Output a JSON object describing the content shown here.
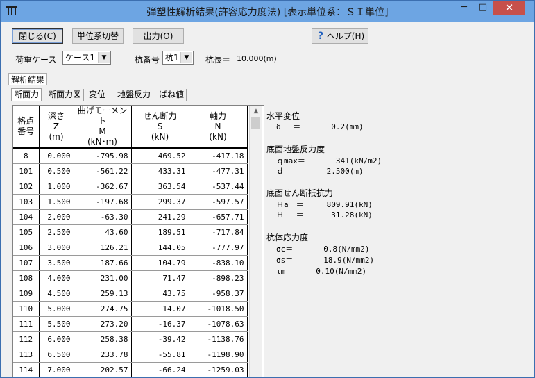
{
  "window": {
    "title": "弾塑性解析結果(許容応力度法) [表示単位系：ＳＩ単位]",
    "minimize": "─",
    "maximize": "□",
    "close": "✕"
  },
  "toolbar": {
    "close_label": "閉じる(C)",
    "unit_switch_label": "単位系切替",
    "output_label": "出力(O)",
    "help_label": "ヘルプ(H)"
  },
  "filters": {
    "load_case_label": "荷重ケース",
    "load_case_value": "ケース1",
    "pile_no_label": "杭番号",
    "pile_no_value": "杭1",
    "pile_length_label": "杭長＝",
    "pile_length_value": "10.000(m)"
  },
  "tabs": {
    "main": "解析結果",
    "sub": [
      "断面力",
      "断面力図",
      "変位",
      "地盤反力",
      "ばね値"
    ]
  },
  "table": {
    "headers": [
      {
        "l1": "格点",
        "l2": "番号",
        "l3": ""
      },
      {
        "l1": "深さ",
        "l2": "Z",
        "l3": "(m)"
      },
      {
        "l1": "曲げモーメント",
        "l2": "M",
        "l3": "(kN･m)"
      },
      {
        "l1": "せん断力",
        "l2": "S",
        "l3": "(kN)"
      },
      {
        "l1": "軸力",
        "l2": "N",
        "l3": "(kN)"
      }
    ],
    "rows": [
      [
        "8",
        "0.000",
        "-795.98",
        "469.52",
        "-417.18"
      ],
      [
        "101",
        "0.500",
        "-561.22",
        "433.31",
        "-477.31"
      ],
      [
        "102",
        "1.000",
        "-362.67",
        "363.54",
        "-537.44"
      ],
      [
        "103",
        "1.500",
        "-197.68",
        "299.37",
        "-597.57"
      ],
      [
        "104",
        "2.000",
        "-63.30",
        "241.29",
        "-657.71"
      ],
      [
        "105",
        "2.500",
        "43.60",
        "189.51",
        "-717.84"
      ],
      [
        "106",
        "3.000",
        "126.21",
        "144.05",
        "-777.97"
      ],
      [
        "107",
        "3.500",
        "187.66",
        "104.79",
        "-838.10"
      ],
      [
        "108",
        "4.000",
        "231.00",
        "71.47",
        "-898.23"
      ],
      [
        "109",
        "4.500",
        "259.13",
        "43.75",
        "-958.37"
      ],
      [
        "110",
        "5.000",
        "274.75",
        "14.07",
        "-1018.50"
      ],
      [
        "111",
        "5.500",
        "273.20",
        "-16.37",
        "-1078.63"
      ],
      [
        "112",
        "6.000",
        "258.38",
        "-39.42",
        "-1138.76"
      ],
      [
        "113",
        "6.500",
        "233.78",
        "-55.81",
        "-1198.90"
      ],
      [
        "114",
        "7.000",
        "202.57",
        "-66.24",
        "-1259.03"
      ]
    ]
  },
  "info": {
    "horizontal_disp_title": "水平変位",
    "delta": "δ　 ＝　　　　0.2(mm)",
    "bottom_reaction_title": "底面地盤反力度",
    "qmax": "ｑmax＝　　　　341(kN/m2)",
    "d": "ｄ　 ＝　　　2.500(m)",
    "bottom_shear_title": "底面せん断抵抗力",
    "ha": "Ｈa　＝　　　809.91(kN)",
    "h": "Ｈ　 ＝　　　 31.28(kN)",
    "pile_stress_title": "杭体応力度",
    "sigma_c": "σc＝　　　　0.8(N/mm2)",
    "sigma_s": "σs＝　　　　18.9(N/mm2)",
    "tau_m": "τm＝　　　0.10(N/mm2)"
  }
}
